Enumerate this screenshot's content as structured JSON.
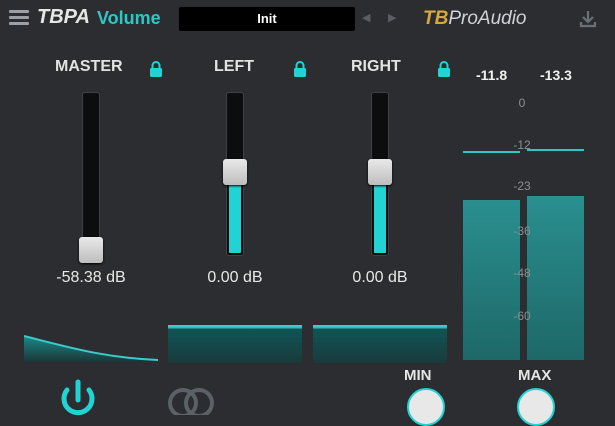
{
  "header": {
    "app_name": "TBPA",
    "plugin_name": "Volume",
    "preset": "Init",
    "brand_tb": "TB",
    "brand_rest": "ProAudio"
  },
  "channels": [
    {
      "label": "MASTER",
      "value": "-58.38 dB",
      "fader_level": 0.0
    },
    {
      "label": "LEFT",
      "value": "0.00 dB",
      "fader_level": 0.5
    },
    {
      "label": "RIGHT",
      "value": "0.00 dB",
      "fader_level": 0.5
    }
  ],
  "meters": {
    "left_peak": "-11.8",
    "right_peak": "-13.3",
    "scale": [
      "0",
      "-12",
      "-23",
      "-36",
      "-48",
      "-60"
    ]
  },
  "bottom": {
    "min_label": "MIN",
    "max_label": "MAX"
  },
  "colors": {
    "accent": "#22d3d3",
    "brand_gold": "#d7a83a",
    "background": "#2b2d30"
  }
}
